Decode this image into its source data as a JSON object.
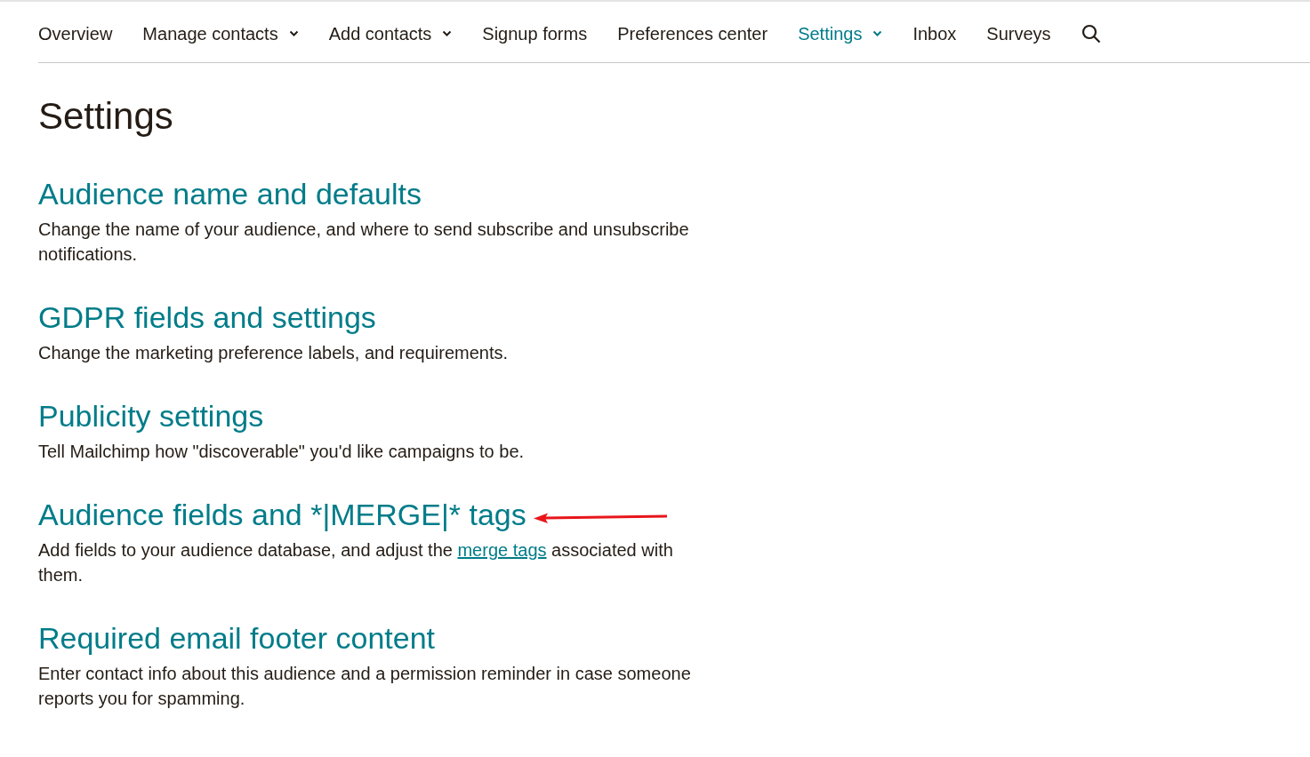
{
  "nav": {
    "items": [
      {
        "label": "Overview",
        "dropdown": false,
        "selected": false
      },
      {
        "label": "Manage contacts",
        "dropdown": true,
        "selected": false
      },
      {
        "label": "Add contacts",
        "dropdown": true,
        "selected": false
      },
      {
        "label": "Signup forms",
        "dropdown": false,
        "selected": false
      },
      {
        "label": "Preferences center",
        "dropdown": false,
        "selected": false
      },
      {
        "label": "Settings",
        "dropdown": true,
        "selected": true
      },
      {
        "label": "Inbox",
        "dropdown": false,
        "selected": false
      },
      {
        "label": "Surveys",
        "dropdown": false,
        "selected": false
      }
    ]
  },
  "page_title": "Settings",
  "sections": [
    {
      "title": "Audience name and defaults",
      "annotated": false,
      "description": [
        {
          "kind": "text",
          "text": "Change the name of your audience, and where to send subscribe and unsubscribe notifications."
        }
      ]
    },
    {
      "title": "GDPR fields and settings",
      "annotated": false,
      "description": [
        {
          "kind": "text",
          "text": "Change the marketing preference labels, and requirements."
        }
      ]
    },
    {
      "title": "Publicity settings",
      "annotated": false,
      "description": [
        {
          "kind": "text",
          "text": "Tell Mailchimp how \"discoverable\" you'd like campaigns to be."
        }
      ]
    },
    {
      "title": "Audience fields and *|MERGE|* tags",
      "annotated": true,
      "description": [
        {
          "kind": "text",
          "text": "Add fields to your audience database, and adjust the "
        },
        {
          "kind": "link",
          "text": "merge tags"
        },
        {
          "kind": "text",
          "text": " associated with them."
        }
      ]
    },
    {
      "title": "Required email footer content",
      "annotated": false,
      "description": [
        {
          "kind": "text",
          "text": "Enter contact info about this audience and a permission reminder in case someone reports you for spamming."
        }
      ]
    }
  ]
}
